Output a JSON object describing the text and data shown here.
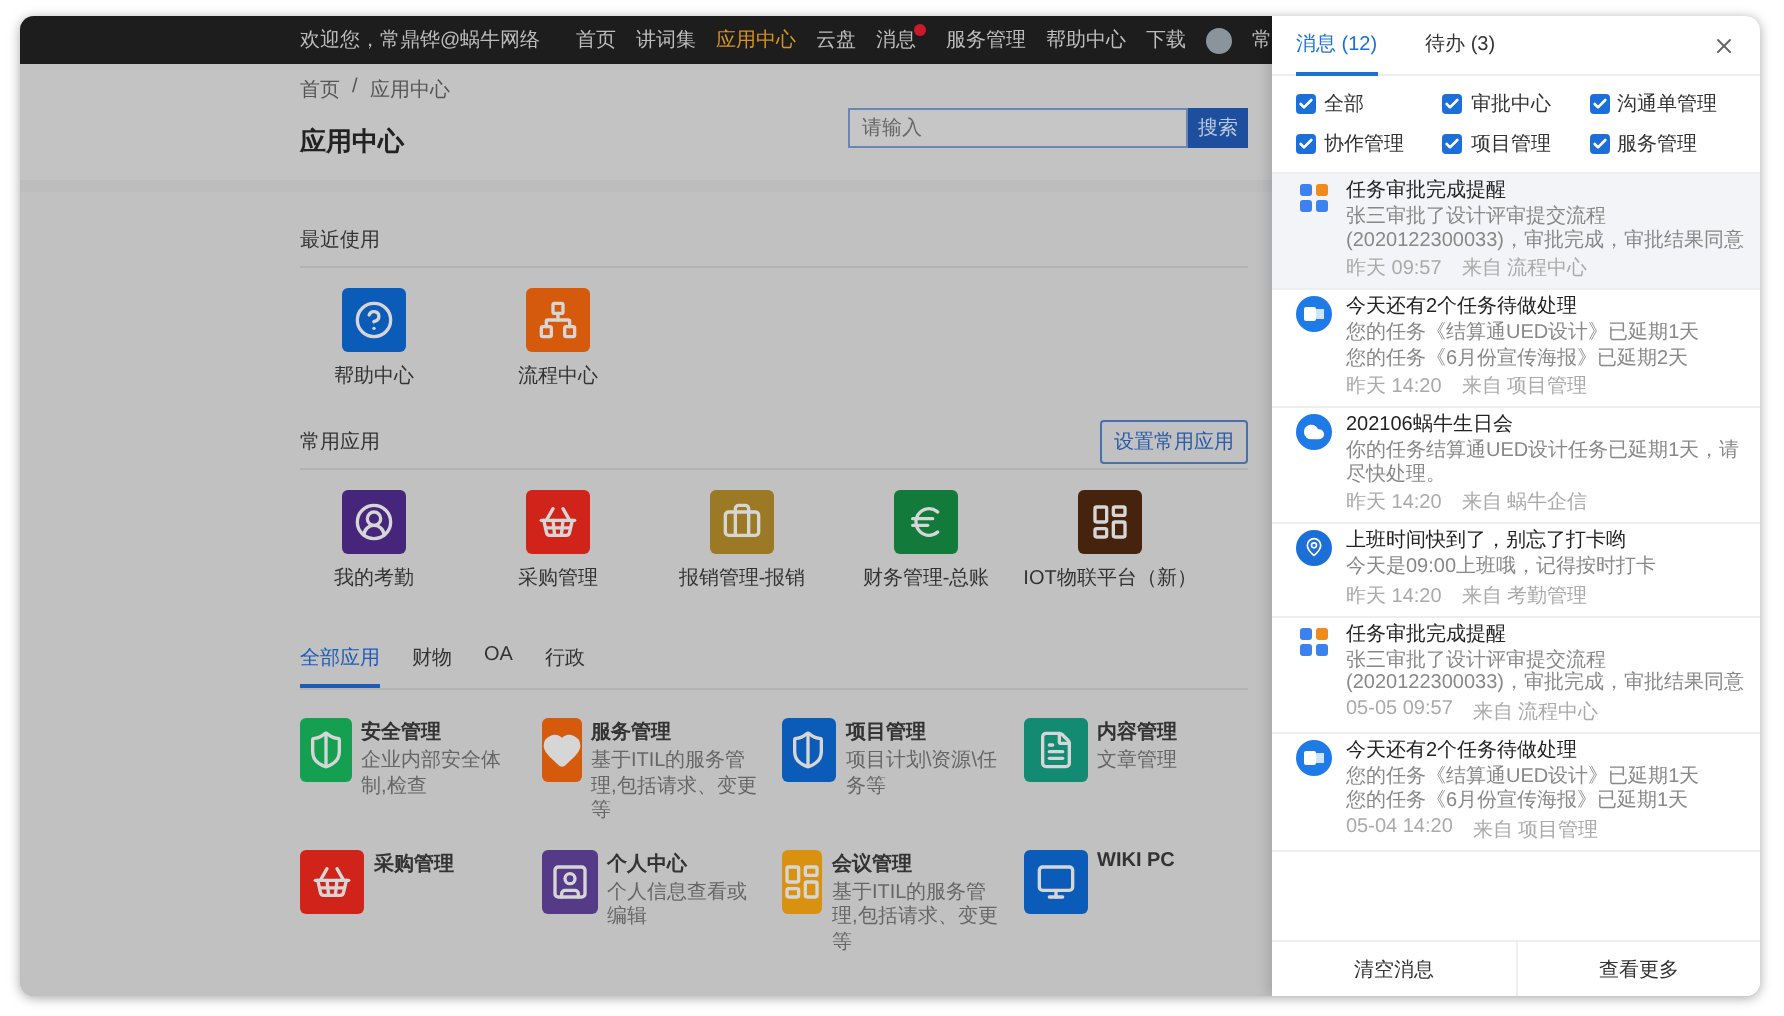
{
  "topbar": {
    "welcome": "欢迎您，常鼎铧@蜗牛网络",
    "nav": [
      {
        "label": "首页",
        "selected": false,
        "badge": false
      },
      {
        "label": "讲词集",
        "selected": false,
        "badge": false
      },
      {
        "label": "应用中心",
        "selected": true,
        "badge": false
      },
      {
        "label": "云盘",
        "selected": false,
        "badge": false
      },
      {
        "label": "消息",
        "selected": false,
        "badge": true
      },
      {
        "label": "服务管理",
        "selected": false,
        "badge": false
      },
      {
        "label": "帮助中心",
        "selected": false,
        "badge": false
      },
      {
        "label": "下载",
        "selected": false,
        "badge": false
      }
    ],
    "user": "常"
  },
  "header": {
    "breadcrumb": [
      "首页",
      "应用中心"
    ],
    "separator": "/",
    "title": "应用中心",
    "search": {
      "placeholder": "请输入",
      "button": "搜索"
    }
  },
  "recent": {
    "title": "最近使用",
    "apps": [
      {
        "label": "帮助中心",
        "kind": "help",
        "color": "#0b5cb8"
      },
      {
        "label": "流程中心",
        "kind": "flow",
        "color": "#d65a0b"
      }
    ]
  },
  "common": {
    "title": "常用应用",
    "action": "设置常用应用",
    "apps": [
      {
        "label": "我的考勤",
        "kind": "user",
        "color": "#45267a"
      },
      {
        "label": "采购管理",
        "kind": "basket",
        "color": "#d0241a"
      },
      {
        "label": "报销管理-报销",
        "kind": "briefcase",
        "color": "#9c7a25"
      },
      {
        "label": "财务管理-总账",
        "kind": "euro",
        "color": "#127a3a"
      },
      {
        "label": "IOT物联平台（新）",
        "kind": "dashboard",
        "color": "#45230d"
      }
    ]
  },
  "category_tabs": [
    {
      "label": "全部应用",
      "selected": true
    },
    {
      "label": "财物",
      "selected": false
    },
    {
      "label": "OA",
      "selected": false
    },
    {
      "label": "行政",
      "selected": false
    }
  ],
  "app_grid": [
    {
      "name": "安全管理",
      "description": "企业内部安全体制,检查",
      "kind": "shield",
      "color": "#14a050"
    },
    {
      "name": "服务管理",
      "description": "基于ITIL的服务管理,包括请求、变更等",
      "kind": "heart",
      "color": "#d65a0b"
    },
    {
      "name": "项目管理",
      "description": "项目计划\\资源\\任务等",
      "kind": "shield",
      "color": "#0b5cb8"
    },
    {
      "name": "内容管理",
      "description": "文章管理",
      "kind": "doc",
      "color": "#138a72"
    },
    {
      "name": "采购管理",
      "kind": "basket",
      "color": "#d0241a"
    },
    {
      "name": "个人中心",
      "description": "个人信息查看或编辑",
      "kind": "badge",
      "color": "#553a88"
    },
    {
      "name": "会议管理",
      "description": "基于ITIL的服务管理,包括请求、变更等",
      "kind": "dashboard",
      "color": "#d9920f"
    },
    {
      "name": "WIKI PC",
      "kind": "monitor",
      "color": "#0b5cb8"
    }
  ],
  "drawer": {
    "tabs": [
      {
        "label": "消息 (12)",
        "selected": true
      },
      {
        "label": "待办 (3)",
        "selected": false
      }
    ],
    "filters": [
      {
        "label": "全部",
        "checked": true
      },
      {
        "label": "审批中心",
        "checked": true
      },
      {
        "label": "沟通单管理",
        "checked": true
      },
      {
        "label": "协作管理",
        "checked": true
      },
      {
        "label": "项目管理",
        "checked": true
      },
      {
        "label": "服务管理",
        "checked": true
      }
    ],
    "messages": [
      {
        "kind": "grid",
        "selected": true,
        "title": "任务审批完成提醒",
        "lines": [
          "张三审批了设计评审提交流程(2020122300033)，审批完成，审批结果同意"
        ],
        "time": "昨天 09:57",
        "source": "来自 流程中心"
      },
      {
        "kind": "outlook",
        "selected": false,
        "title": "今天还有2个任务待做处理",
        "lines": [
          "您的任务《结算通UED设计》已延期1天",
          "您的任务《6月份宣传海报》已延期2天"
        ],
        "time": "昨天 14:20",
        "source": "来自 项目管理"
      },
      {
        "kind": "cloud",
        "selected": false,
        "title": "202106蜗牛生日会",
        "lines": [
          "你的任务结算通UED设计任务已延期1天，请尽快处理。"
        ],
        "time": "昨天 14:20",
        "source": "来自 蜗牛企信"
      },
      {
        "kind": "pin",
        "selected": false,
        "title": "上班时间快到了，别忘了打卡哟",
        "lines": [
          "今天是09:00上班哦，记得按时打卡"
        ],
        "time": "昨天 14:20",
        "source": "来自 考勤管理"
      },
      {
        "kind": "grid",
        "selected": false,
        "title": "任务审批完成提醒",
        "lines": [
          "张三审批了设计评审提交流程(2020122300033)，审批完成，审批结果同意"
        ],
        "time": "05-05 09:57",
        "source": "来自 流程中心"
      },
      {
        "kind": "outlook",
        "selected": false,
        "title": "今天还有2个任务待做处理",
        "lines": [
          "您的任务《结算通UED设计》已延期1天",
          "您的任务《6月份宣传海报》已延期1天"
        ],
        "time": "05-04 14:20",
        "source": "来自 项目管理"
      }
    ],
    "footer": [
      "清空消息",
      "查看更多"
    ]
  }
}
